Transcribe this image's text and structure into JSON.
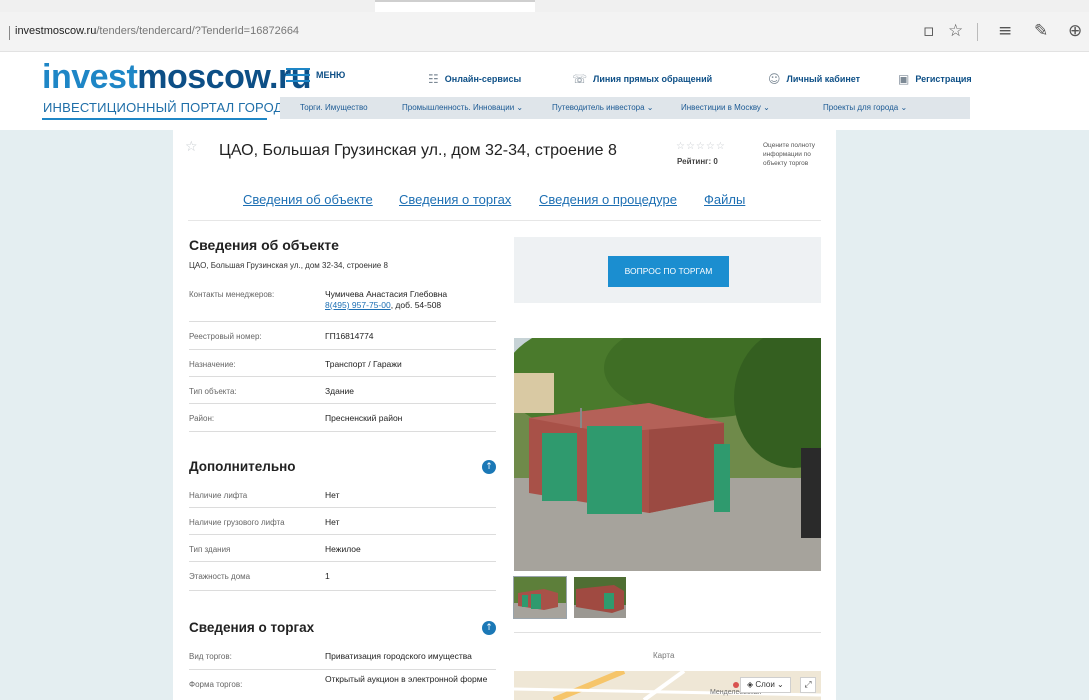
{
  "browser": {
    "url_host": "investmoscow.ru",
    "url_path": "/tenders/tendercard/?TenderId=16872664",
    "icons": [
      "reading-view-icon",
      "favorite-star-icon",
      "hub-icon",
      "web-note-icon",
      "share-icon"
    ]
  },
  "site": {
    "logo_part1": "invest",
    "logo_part2": "moscow.ru",
    "tagline": "ИНВЕСТИЦИОННЫЙ ПОРТАЛ ГОРОДА МОСКВЫ",
    "menu_label": "МЕНЮ",
    "top_links": {
      "online": "Онлайн-сервисы",
      "hotline": "Линия прямых обращений",
      "cabinet": "Личный кабинет",
      "register": "Регистрация"
    },
    "subnav": {
      "trades": "Торги. Имущество",
      "industry": "Промышленность. Инновации ⌄",
      "guide": "Путеводитель инвестора ⌄",
      "investments": "Инвестиции в Москву ⌄",
      "projects": "Проекты для города ⌄"
    }
  },
  "tender": {
    "title": "ЦАО, Большая Грузинская ул., дом 32-34, строение 8",
    "rating_stars": "☆☆☆☆☆",
    "rating_label": "Рейтинг: 0",
    "rate_hint": "Оцените полноту информации по объекту торгов",
    "tabs": {
      "object": "Сведения об объекте",
      "trades": "Сведения о торгах",
      "procedure": "Сведения о процедуре",
      "files": "Файлы"
    }
  },
  "object_info": {
    "heading": "Сведения об объекте",
    "address": "ЦАО, Большая Грузинская ул., дом 32-34, строение 8",
    "contacts_key": "Контакты менеджеров:",
    "manager_name": "Чумичева Анастасия Глебовна",
    "manager_phone": "8(495) 957-75-00",
    "manager_ext": ", доб. 54-508",
    "registry_key": "Реестровый номер:",
    "registry_value": "ГП16814774",
    "purpose_key": "Назначение:",
    "purpose_value": "Транспорт / Гаражи",
    "type_key": "Тип объекта:",
    "type_value": "Здание",
    "district_key": "Район:",
    "district_value": "Пресненский район"
  },
  "additional": {
    "heading": "Дополнительно",
    "lift_key": "Наличие лифта",
    "lift_value": "Нет",
    "cargo_key": "Наличие грузового лифта",
    "cargo_value": "Нет",
    "building_key": "Тип здания",
    "building_value": "Нежилое",
    "floors_key": "Этажность дома",
    "floors_value": "1"
  },
  "trades": {
    "heading": "Сведения о торгах",
    "kind_key": "Вид торгов:",
    "kind_value": "Приватизация городского имущества",
    "form_key": "Форма торгов:",
    "form_value": "Открытый аукцион в электронной форме"
  },
  "aside": {
    "ask_button": "ВОПРОС ПО ТОРГАМ",
    "map_label": "Карта",
    "map_layers": "Слои ⌄",
    "map_street": "Менделеевская"
  },
  "colors": {
    "brand_blue": "#1e86c6",
    "brand_dark": "#0d4f86",
    "button_blue": "#1b8ed0",
    "page_bg": "#e4eef1"
  }
}
